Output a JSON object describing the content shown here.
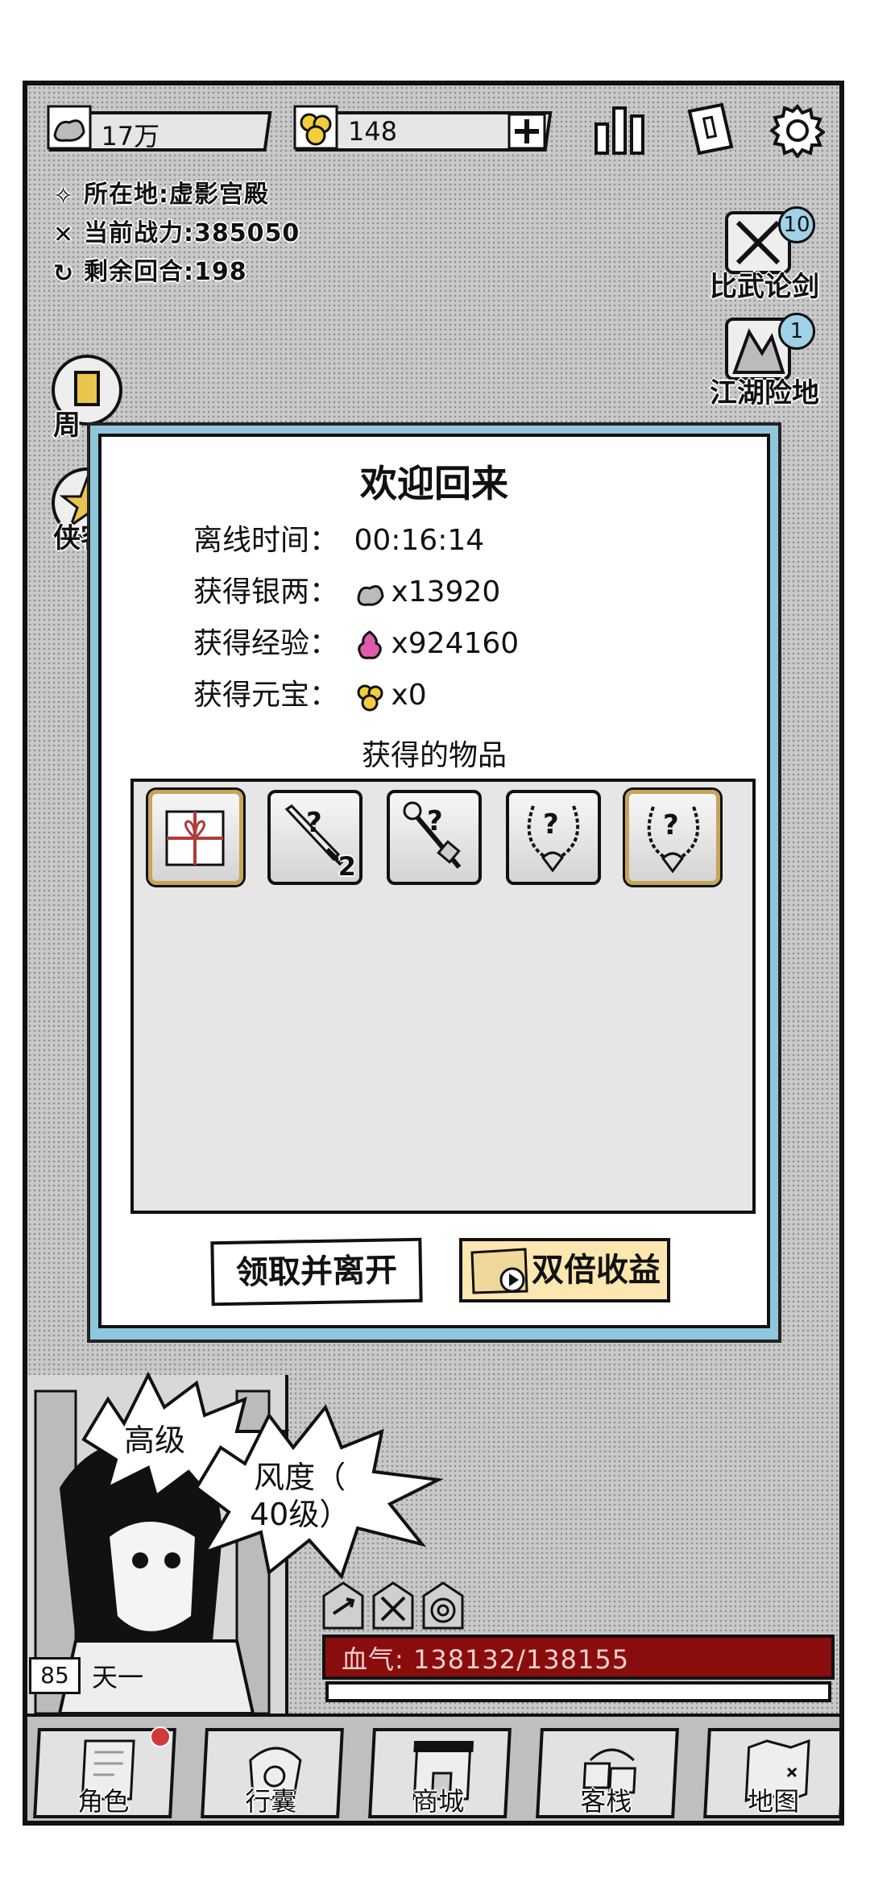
{
  "top_bar": {
    "silver": "17万",
    "gold": "148",
    "add_icon": "plus-icon",
    "icons": [
      "ranking-icon",
      "scroll-icon",
      "gear-icon"
    ]
  },
  "status": {
    "location_label": "所在地",
    "location_value": "虚影宫殿",
    "power_label": "当前战力",
    "power_value": "385050",
    "rounds_label": "剩余回合",
    "rounds_value": "198"
  },
  "side_buttons": {
    "arena": {
      "label": "比武论剑",
      "badge": "10"
    },
    "dungeon": {
      "label": "江湖险地",
      "badge": "1"
    }
  },
  "left_partial": {
    "top": "周",
    "bottom": "侠客"
  },
  "dialog": {
    "title": "欢迎回来",
    "offline_label": "离线时间：",
    "offline_value": "00:16:14",
    "silver_label": "获得银两：",
    "silver_value": "x13920",
    "exp_label": "获得经验：",
    "exp_value": "x924160",
    "ingot_label": "获得元宝：",
    "ingot_value": "x0",
    "items_title": "获得的物品",
    "items": [
      {
        "name": "gift-box-icon",
        "count": "",
        "rare": true
      },
      {
        "name": "mystery-sword-icon",
        "count": "2",
        "rare": false
      },
      {
        "name": "mystery-staff-icon",
        "count": "",
        "rare": false
      },
      {
        "name": "mystery-necklace-icon",
        "count": "",
        "rare": false
      },
      {
        "name": "mystery-necklace-icon",
        "count": "",
        "rare": true
      }
    ],
    "claim_button": "领取并离开",
    "double_button": "双倍收益"
  },
  "character": {
    "speech_left": "高级",
    "speech_right_line1": "风度（",
    "speech_right_line2": "40级）",
    "level": "85",
    "name": "天一",
    "hp_label": "血气:",
    "hp_value": "138132/138155"
  },
  "nav": [
    "角色",
    "行囊",
    "商城",
    "客栈",
    "地图"
  ],
  "colors": {
    "hp_bar": "#8a0d0d",
    "dialog_border": "#8fc6dc",
    "double_button": "#fde7b0"
  }
}
